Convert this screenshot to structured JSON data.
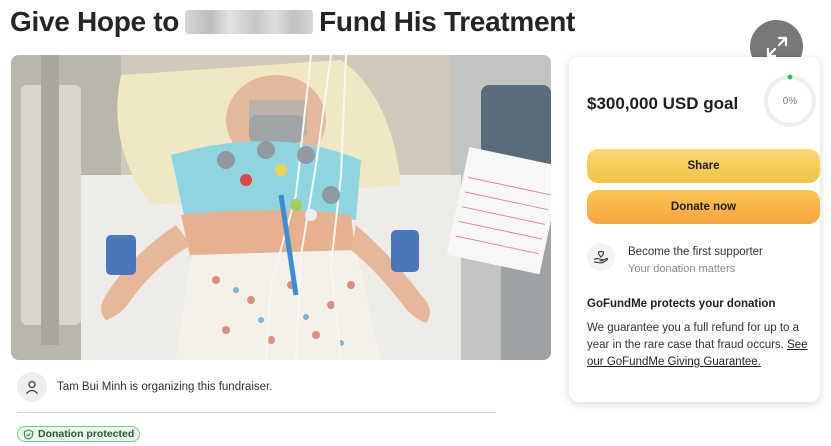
{
  "header": {
    "title_part1": "Give Hope to",
    "title_part2": "Fund His Treatment"
  },
  "photo": {
    "description": ""
  },
  "organizer": {
    "text": "Tam Bui Minh is organizing this fundraiser."
  },
  "badge": {
    "label": "Donation protected"
  },
  "card": {
    "goal": "$300,000 USD goal",
    "progress_label": "0%",
    "progress_fraction": 0.0,
    "share_label": "Share",
    "donate_label": "Donate now",
    "supporter_title": "Become the first supporter",
    "supporter_sub": "Your donation matters",
    "protect_title": "GoFundMe protects your donation",
    "protect_text": "We guarantee you a full refund for up to a year in the rare case that fraud occurs. ",
    "protect_link": "See our GoFundMe Giving Guarantee."
  },
  "colors": {
    "share_button": "#f2c94c",
    "donate_button": "#f7ac3e",
    "protected_green": "#2f8f46",
    "progress_dot": "#2fbf5b"
  },
  "icons": [
    "expand-icon",
    "user-icon",
    "heart-hand-icon",
    "shield-check-icon"
  ]
}
